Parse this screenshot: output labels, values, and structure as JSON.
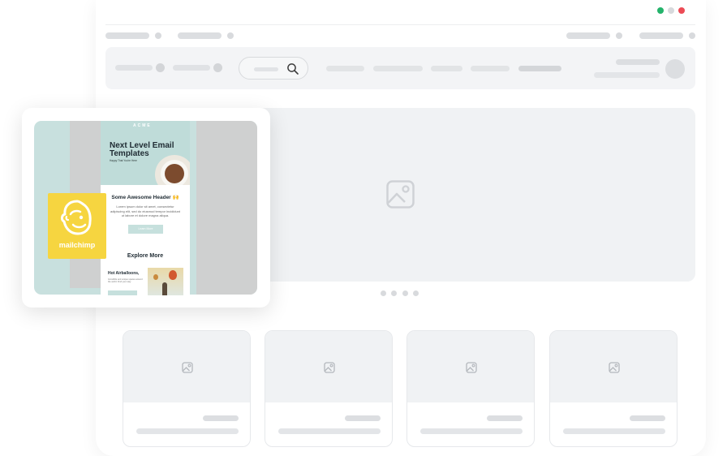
{
  "window": {
    "controls": [
      {
        "name": "maximize",
        "color": "#24b36b"
      },
      {
        "name": "minimize",
        "color": "#d7d9dc"
      },
      {
        "name": "close",
        "color": "#ec4b55"
      }
    ]
  },
  "search": {
    "icon": "search-icon"
  },
  "hero": {
    "icon": "image-placeholder-icon",
    "carousel_dots": 4
  },
  "cards": [
    {
      "icon": "image-placeholder-icon"
    },
    {
      "icon": "image-placeholder-icon"
    },
    {
      "icon": "image-placeholder-icon"
    },
    {
      "icon": "image-placeholder-icon"
    }
  ],
  "email_preview": {
    "logo_text": "ACME",
    "hero_title": "Next Level Email Templates",
    "hero_subtitle": "Happy That You're Here",
    "section_title": "Some Awesome Header 🙌",
    "section_body": "Lorem ipsum dolor sit amet, consectetur adipiscing elit, sed do eiusmod tempor incididunt ut labore et dolore magna aliqua.",
    "button_label": "Learn More",
    "explore_title": "Explore More",
    "item_title": "Hot Airballoons,",
    "item_body": "Incredible and unique spaces around the world. Find your stay.",
    "colors": {
      "mint": "#c8e0de",
      "brand_yellow": "#f6d540"
    }
  },
  "mailchimp": {
    "wordmark": "mailchimp",
    "icon": "mailchimp-freddie-icon"
  }
}
